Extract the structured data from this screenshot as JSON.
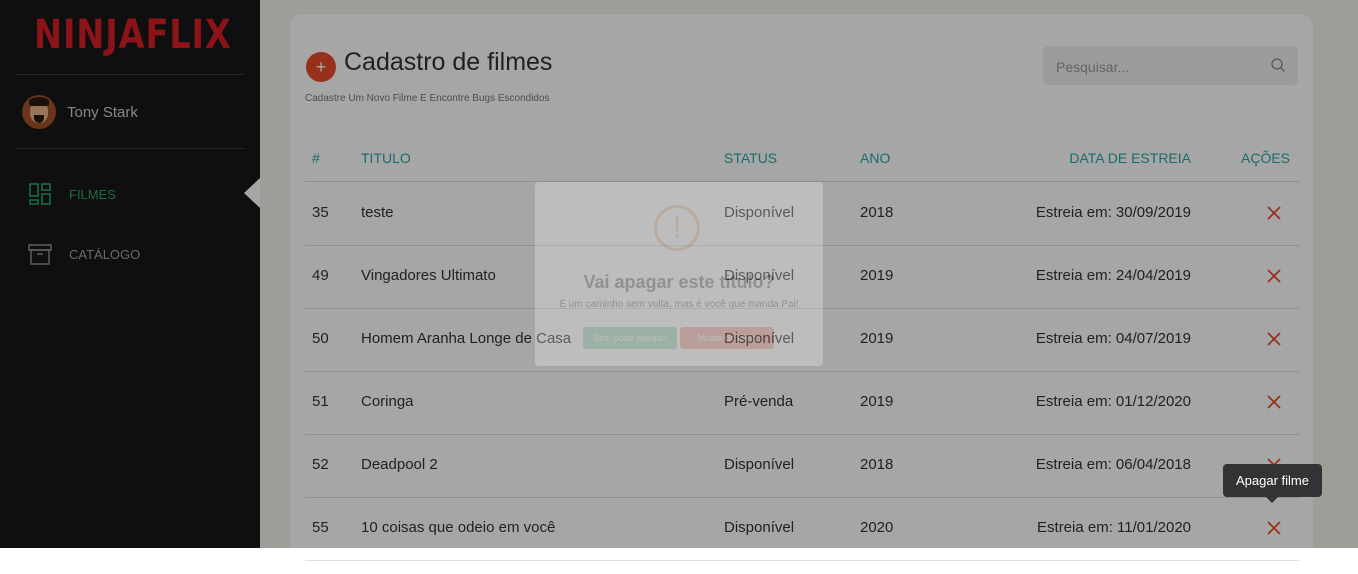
{
  "brand": {
    "logo_text": "NINJAFLIX"
  },
  "user": {
    "name": "Tony Stark"
  },
  "nav": {
    "items": [
      {
        "label": "FILMES",
        "icon": "dashboard-icon",
        "active": true
      },
      {
        "label": "CATÁLOGO",
        "icon": "archive-box-icon",
        "active": false
      }
    ]
  },
  "page": {
    "add_button_symbol": "+",
    "title": "Cadastro de filmes",
    "subtitle": "Cadastre Um Novo Filme E Encontre Bugs Escondidos",
    "search": {
      "placeholder": "Pesquisar..."
    }
  },
  "table": {
    "headers": [
      "#",
      "TITULO",
      "STATUS",
      "ANO",
      "DATA DE ESTREIA",
      "AÇÕES"
    ],
    "rows": [
      {
        "id": "35",
        "title": "teste",
        "status": "Disponível",
        "year": "2018",
        "release": "Estreia em: 30/09/2019"
      },
      {
        "id": "49",
        "title": "Vingadores Ultimato",
        "status": "Disponível",
        "year": "2019",
        "release": "Estreia em: 24/04/2019"
      },
      {
        "id": "50",
        "title": "Homem Aranha Longe de Casa",
        "status": "Disponível",
        "year": "2019",
        "release": "Estreia em: 04/07/2019"
      },
      {
        "id": "51",
        "title": "Coringa",
        "status": "Pré-venda",
        "year": "2019",
        "release": "Estreia em: 01/12/2020"
      },
      {
        "id": "52",
        "title": "Deadpool 2",
        "status": "Disponível",
        "year": "2018",
        "release": "Estreia em: 06/04/2018"
      },
      {
        "id": "55",
        "title": "10 coisas que odeio em você",
        "status": "Disponível",
        "year": "2020",
        "release": "Estreia em: 11/01/2020"
      }
    ]
  },
  "modal": {
    "icon": "!",
    "title": "Vai apagar este titulo?",
    "text": "É um caminho sem volta, mas é você que manda Pai!",
    "confirm_label": "Sim, pode apagar!",
    "cancel_label": "Mudei de ideia"
  },
  "tooltip": {
    "text": "Apagar filme"
  },
  "colors": {
    "brand_red": "#d81f26",
    "accent_teal": "#28a5a5",
    "active_green": "#26a862",
    "delete_red": "#e84c2a",
    "add_button": "#e84c2a"
  }
}
